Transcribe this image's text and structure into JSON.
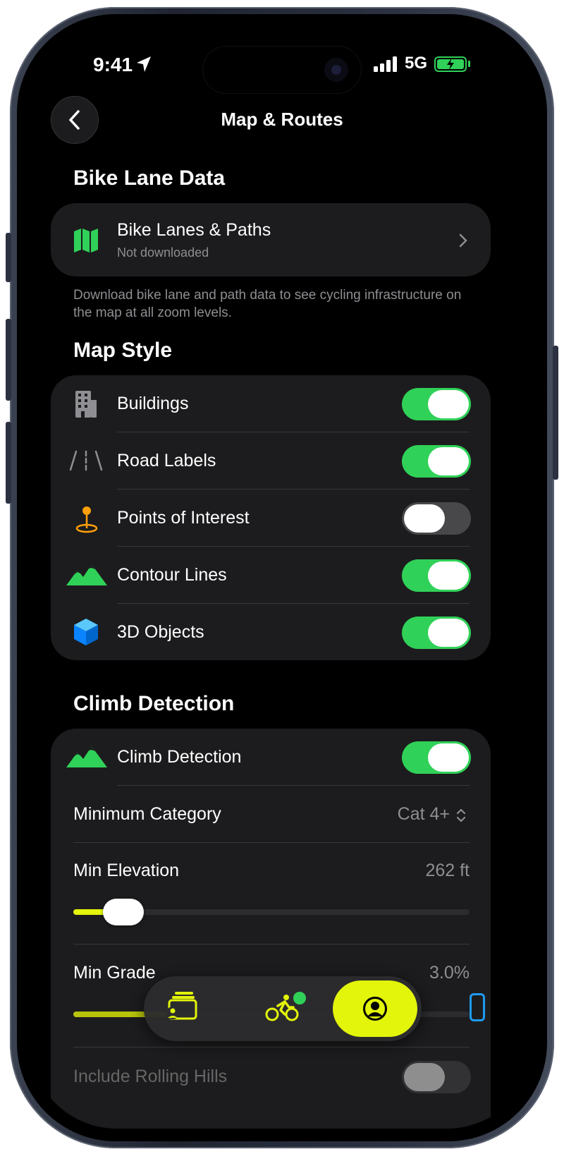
{
  "status": {
    "time": "9:41",
    "network": "5G"
  },
  "nav": {
    "title": "Map & Routes"
  },
  "bike_lane": {
    "section_title": "Bike Lane Data",
    "row_label": "Bike Lanes & Paths",
    "row_sub": "Not downloaded",
    "note": "Download bike lane and path data to see cycling infrastructure on the map at all zoom levels."
  },
  "map_style": {
    "section_title": "Map Style",
    "rows": [
      {
        "label": "Buildings",
        "on": true
      },
      {
        "label": "Road Labels",
        "on": true
      },
      {
        "label": "Points of Interest",
        "on": false
      },
      {
        "label": "Contour Lines",
        "on": true
      },
      {
        "label": "3D Objects",
        "on": true
      }
    ]
  },
  "climb": {
    "section_title": "Climb Detection",
    "toggle_label": "Climb Detection",
    "toggle_on": true,
    "min_category_label": "Minimum Category",
    "min_category_value": "Cat 4+",
    "min_elevation_label": "Min Elevation",
    "min_elevation_value": "262 ft",
    "min_elevation_fraction": 0.115,
    "min_grade_label": "Min Grade",
    "min_grade_value": "3.0%",
    "next_row_label": "Include Rolling Hills"
  },
  "colors": {
    "accent": "#e3f50a",
    "toggle_on": "#30d158",
    "card": "#1c1c1e"
  }
}
